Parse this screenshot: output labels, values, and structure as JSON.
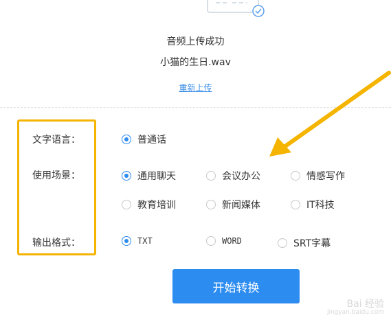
{
  "upload": {
    "status": "音频上传成功",
    "filename": "小猫的生日.wav",
    "reupload_label": "重新上传"
  },
  "form": {
    "language": {
      "label": "文字语言：",
      "options": [
        {
          "label": "普通话",
          "checked": true
        }
      ]
    },
    "scene": {
      "label": "使用场景：",
      "options": [
        {
          "label": "通用聊天",
          "checked": true
        },
        {
          "label": "会议办公",
          "checked": false
        },
        {
          "label": "情感写作",
          "checked": false
        },
        {
          "label": "教育培训",
          "checked": false
        },
        {
          "label": "新闻媒体",
          "checked": false
        },
        {
          "label": "IT科技",
          "checked": false
        }
      ]
    },
    "output": {
      "label": "输出格式：",
      "options": [
        {
          "label": "TXT",
          "checked": true
        },
        {
          "label": "WORD",
          "checked": false
        },
        {
          "label": "SRT字幕",
          "checked": false
        }
      ]
    }
  },
  "start_button_label": "开始转换",
  "watermark": {
    "line1": "Bai 经验",
    "line2": "jingyan.baidu.com"
  },
  "colors": {
    "accent": "#2d8cf0",
    "highlight": "#f4b400",
    "link": "#3a8ee6"
  }
}
